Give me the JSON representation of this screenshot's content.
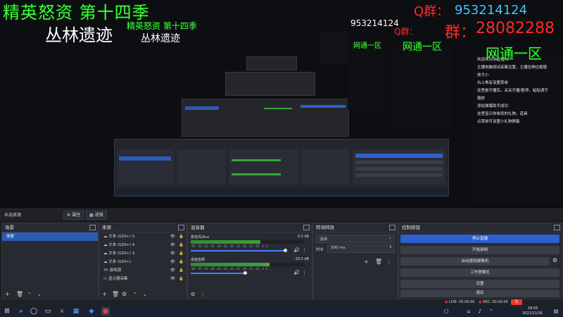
{
  "overlay": {
    "title_left": "精英怒资 第十四季",
    "subtitle_left": "丛林遗迹",
    "title_mid": "精英怒资 第十四季",
    "subtitle_mid": "丛林遗迹",
    "qq_label": "Q群：",
    "qq_number": "953214124",
    "qq_number_mid": "953214124",
    "red_label_mid": "Q群：",
    "red_number": "28082288",
    "red_label": "群：",
    "region_big": "网通一区",
    "region_mid": "网通一区",
    "region_small": "网通一区"
  },
  "side_notes": [
    "欢迎来到本直播间",
    "主播电脑测试采集位置，主播拉伸边框缩",
    "放大小",
    "右上角有设置菜单",
    "这里是开播后，关关开播/暂停，粘贴调节",
    "缩放",
    "添加弹幕助手成功",
    "这里显示你收到的礼物，道具",
    "点菜单可设置小礼物屏蔽"
  ],
  "scene_bar": {
    "label": "未选择源",
    "tab_properties": "属性",
    "tab_filters": "滤镜"
  },
  "scenes": {
    "title": "场景",
    "items": [
      "场景"
    ],
    "selected": 0
  },
  "sources": {
    "title": "来源",
    "items": [
      {
        "icon": "cloud-icon",
        "label": "文本 (GDI+) 5"
      },
      {
        "icon": "cloud-icon",
        "label": "文本 (GDI+) 4"
      },
      {
        "icon": "cloud-icon",
        "label": "文本 (GDI+) 3"
      },
      {
        "icon": "cloud-icon",
        "label": "文本 (GDI+)"
      },
      {
        "icon": "gamepad-icon",
        "label": "游戏源"
      },
      {
        "icon": "monitor-icon",
        "label": "显示器采集"
      }
    ]
  },
  "mixer": {
    "title": "混音器",
    "channels": [
      {
        "name": "麦克风/Aux",
        "db": "0.0 dB",
        "level": 0.62,
        "volume": 0.96
      },
      {
        "name": "桌面音频",
        "db": "-18.5 dB",
        "level": 0.7,
        "volume": 0.55
      }
    ],
    "ticks": [
      "-60",
      "-55",
      "-50",
      "-45",
      "-40",
      "-35",
      "-30",
      "-25",
      "-20",
      "-15",
      "-10",
      "-5",
      "0"
    ]
  },
  "transitions": {
    "title": "转场特效",
    "type": "淡出",
    "duration_label": "时长",
    "duration": "300 ms"
  },
  "controls": {
    "title": "控制按钮",
    "buttons": [
      "停止直播",
      "开始录制",
      "启动虚拟摄像机",
      "工作室模式",
      "设置",
      "退出"
    ]
  },
  "status": {
    "live_label": "LIVE: 00:00:00",
    "rec_label": "REC: 00:00:00"
  },
  "taskbar": {
    "time": "18:05",
    "date": "2022/11/16"
  },
  "colors": {
    "accent": "#2e5fd0",
    "selected_row": "#2b5bb6",
    "overlay_green": "#3bff3b",
    "overlay_red": "#ff2a2a"
  }
}
